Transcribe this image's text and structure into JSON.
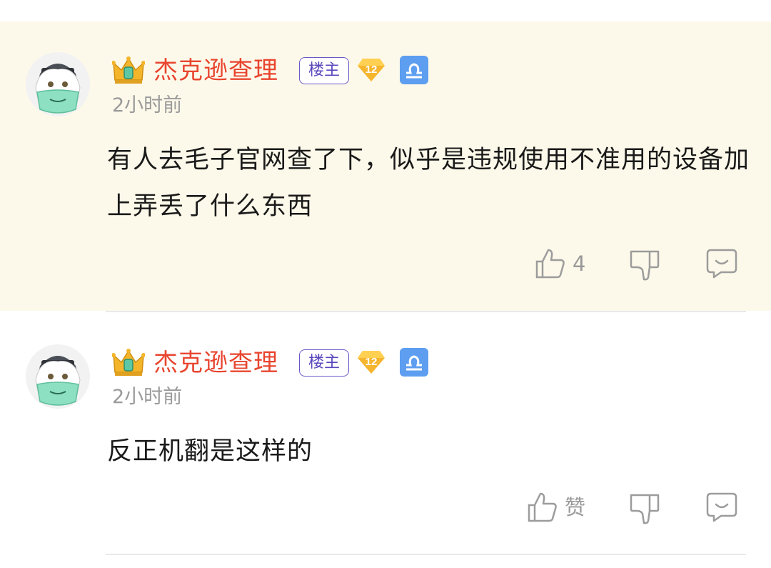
{
  "comments": [
    {
      "username": "杰克逊查理",
      "op_badge": "楼主",
      "level": "12",
      "time": "2小时前",
      "text": "有人去毛子官网查了下，似乎是违规使用不准用的设备加上弄丢了什么东西",
      "like_label": "4",
      "highlighted": true
    },
    {
      "username": "杰克逊查理",
      "op_badge": "楼主",
      "level": "12",
      "time": "2小时前",
      "text": "反正机翻是这样的",
      "like_label": "赞",
      "highlighted": false
    }
  ],
  "colors": {
    "highlight_bg": "#fdf9ea",
    "username": "#e8452f",
    "op_badge": "#5a47bd",
    "level_badge": "#f6b52e",
    "zodiac_badge": "#5d9ef0",
    "meta_text": "#9a9a9a"
  },
  "icons": {
    "crown": "crown-icon",
    "level": "level-diamond-icon",
    "zodiac": "libra-icon",
    "like": "thumbs-up-icon",
    "dislike": "thumbs-down-icon",
    "reply": "reply-bubble-icon"
  }
}
